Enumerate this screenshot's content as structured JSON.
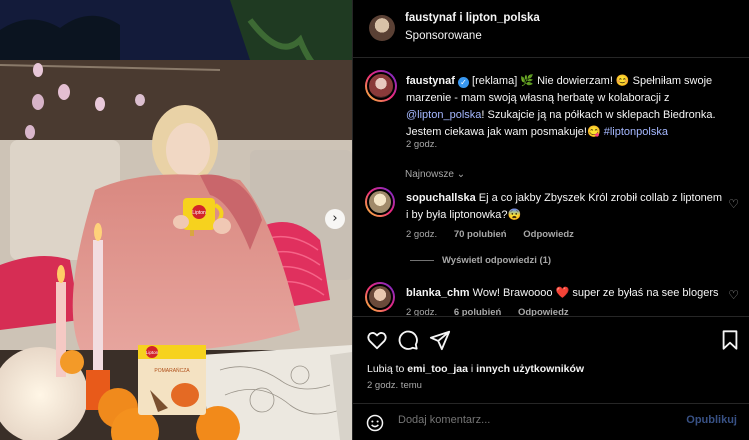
{
  "header": {
    "users": "faustynaf i lipton_polska",
    "sponsored": "Sponsorowane"
  },
  "post": {
    "username": "faustynaf",
    "caption_part1": " [reklama] 🌿 Nie dowierzam! 😊 Spełniłam swoje marzenie - mam swoją własną herbatę w kolaboracji z ",
    "mention": "@lipton_polska",
    "caption_part2": "! Szukajcie ją na półkach w sklepach Biedronka. Jestem ciekawa jak wam posmakuje!😋 ",
    "hashtag": "#liptonpolska",
    "time": "2 godz."
  },
  "sort_label": "Najnowsze ⌄",
  "comments": [
    {
      "username": "sopuchallska",
      "text": " Ej a co jakby Zbyszek Król zrobił collab z liptonem i by była liptonowka?😨",
      "time": "2 godz.",
      "likes": "70 polubień",
      "reply": "Odpowiedz"
    },
    {
      "username": "blanka_chm",
      "text": " Wow! Brawoooo ❤️ super ze byłaś na see blogers",
      "time": "2 godz.",
      "likes": "6 polubień",
      "reply": "Odpowiedz"
    }
  ],
  "view_replies": "Wyświetl odpowiedzi (1)",
  "likes_line": {
    "prefix": "Lubią to ",
    "user": "emi_too_jaa",
    "middle": " i ",
    "others": "innych użytkowników"
  },
  "time_ago": "2 godz. temu",
  "comment_input": {
    "placeholder": "Dodaj komentarz...",
    "publish": "Opublikuj"
  },
  "photo": {
    "mug_brand": "Lipton",
    "box_brand": "Lipton",
    "box_label": "POMARAŃCZA"
  },
  "colors": {
    "background": "#000000",
    "link": "#a5b8ff",
    "muted": "#a8a8a8",
    "publish": "#385185",
    "verified": "#3897f0"
  },
  "icons": [
    "heart-icon",
    "comment-icon",
    "share-icon",
    "bookmark-icon",
    "emoji-icon",
    "verified-icon",
    "chevron-right-icon"
  ]
}
